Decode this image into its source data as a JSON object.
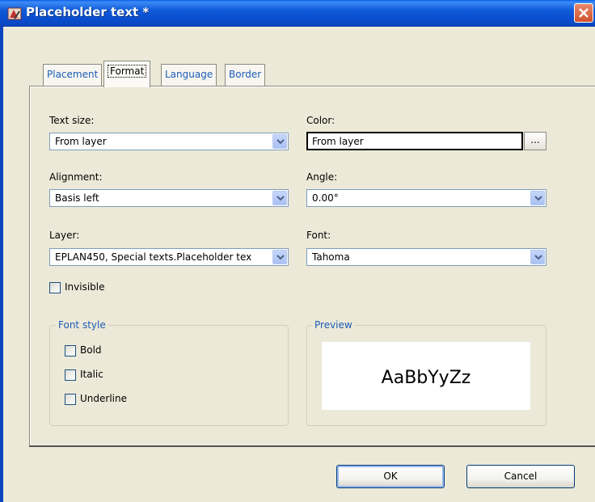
{
  "window": {
    "title": "Placeholder text *",
    "icon": "placeholder-text-icon"
  },
  "tabs": [
    {
      "label": "Placement",
      "active": false
    },
    {
      "label": "Format",
      "active": true
    },
    {
      "label": "Language",
      "active": false
    },
    {
      "label": "Border",
      "active": false
    }
  ],
  "format": {
    "text_size_label": "Text size:",
    "text_size_value": "From layer",
    "color_label": "Color:",
    "color_value": "From layer",
    "color_button": "...",
    "alignment_label": "Alignment:",
    "alignment_value": "Basis left",
    "angle_label": "Angle:",
    "angle_value": "0.00°",
    "layer_label": "Layer:",
    "layer_value": "EPLAN450, Special texts.Placeholder tex",
    "font_label": "Font:",
    "font_value": "Tahoma",
    "invisible_label": "Invisible",
    "invisible_checked": false
  },
  "font_style": {
    "legend": "Font style",
    "bold_label": "Bold",
    "italic_label": "Italic",
    "underline_label": "Underline"
  },
  "preview": {
    "legend": "Preview",
    "sample": "AaBbYyZz"
  },
  "buttons": {
    "ok": "OK",
    "cancel": "Cancel"
  }
}
